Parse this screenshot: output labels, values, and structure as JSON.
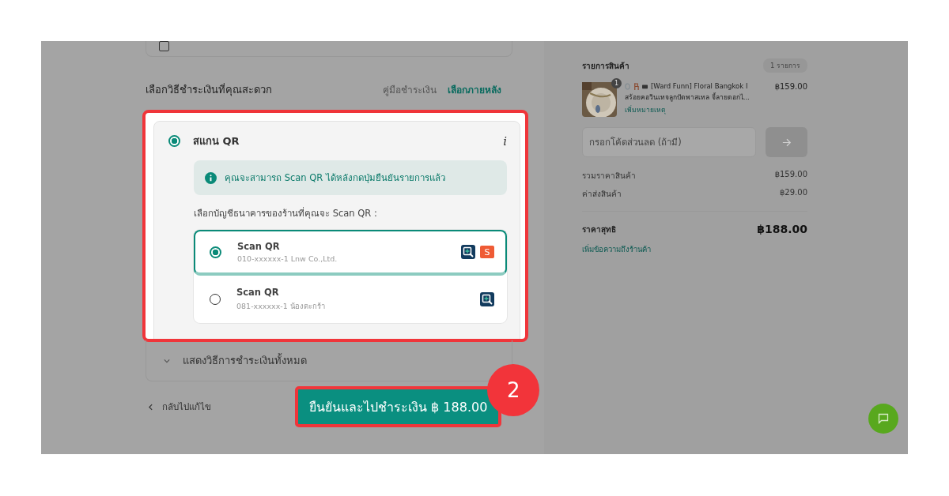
{
  "top_card": {
    "checked": false
  },
  "payment": {
    "heading": "เลือกวิธีชำระเงินที่คุณสะดวก",
    "links": [
      {
        "label": "คู่มือชำระเงิน",
        "kind": "guide"
      },
      {
        "label": "เลือกภายหลัง",
        "kind": "later"
      }
    ],
    "method": {
      "label": "สแกน QR",
      "selected": true,
      "info": "i"
    },
    "notice": "คุณจะสามารถ Scan QR ได้หลังกดปุ่มยืนยันรายการแล้ว",
    "account_prompt": "เลือกบัญชีธนาคารของร้านที่คุณจะ Scan QR :",
    "accounts": [
      {
        "title": "Scan QR",
        "detail": "010-xxxxxx-1  Lnw Co.,Ltd.",
        "selected": true,
        "wallets": [
          {
            "kind": "qr"
          },
          {
            "kind": "shop",
            "label": "S"
          }
        ]
      },
      {
        "title": "Scan QR",
        "detail": "081-xxxxxx-1  น้องตะกร้า",
        "selected": false,
        "wallets": [
          {
            "kind": "qr"
          }
        ]
      }
    ],
    "show_all": "แสดงวิธีการชำระเงินทั้งหมด"
  },
  "back_link": "กลับไปแก้ไข",
  "confirm_button": "ยืนยันและไปชำระเงิน ฿ 188.00",
  "step_badge": "2",
  "summary": {
    "heading": "รายการสินค้า",
    "count": "1 รายการ",
    "items": [
      {
        "quantity": "1",
        "title_lines": [
          "[Ward Funn] Floral Bangkok I",
          "สร้อยคอวินเทจลูกปัดพาสเทล จี้ลายดอกไ..."
        ],
        "price": "฿159.00",
        "note_link": "เพิ่มหมายเหตุ"
      }
    ],
    "coupon": {
      "placeholder": "กรอกโค้ดส่วนลด (ถ้ามี)"
    },
    "rows": [
      {
        "label": "รวมราคาสินค้า",
        "value": "฿159.00"
      },
      {
        "label": "ค่าส่งสินค้า",
        "value": "฿29.00"
      }
    ],
    "total": {
      "label": "ราคาสุทธิ",
      "value": "฿188.00"
    },
    "message_link": "เพิ่มข้อความถึงร้านค้า"
  }
}
